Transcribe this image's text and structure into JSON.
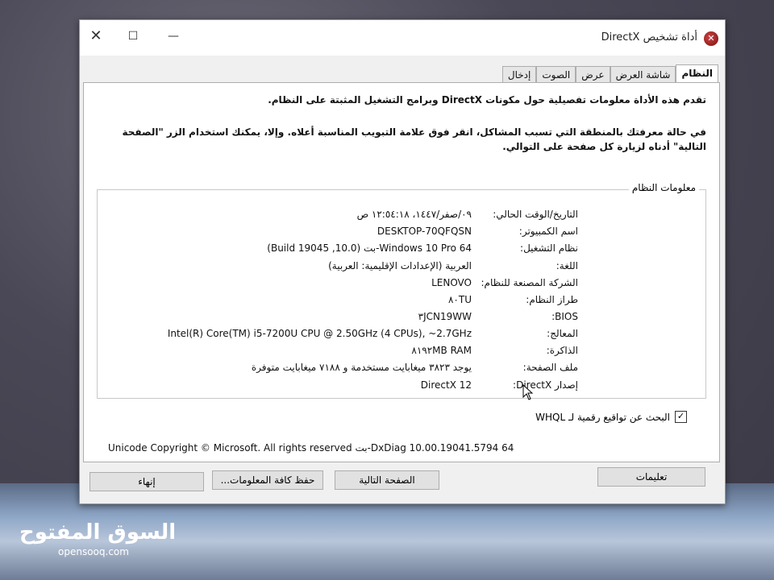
{
  "window": {
    "title": "أداة تشخيص DirectX",
    "close_glyph": "✕",
    "maximize_glyph": "☐",
    "minimize_glyph": "—"
  },
  "tabs": [
    "النظام",
    "شاشة العرض",
    "عرض",
    "الصوت",
    "إدخال"
  ],
  "intro": {
    "line1": "تقدم هذه الأداة معلومات تفصيلية حول مكونات DirectX وبرامج التشغيل المثبتة على النظام.",
    "line2": "في حالة معرفتك بالمنطقة التي تسبب المشاكل، انقر فوق علامة التبويب المناسبة أعلاه. وإلا، يمكنك استخدام الزر \"الصفحة التالية\" أدناه لزيارة كل صفحة على التوالي."
  },
  "system_info": {
    "title": "معلومات النظام",
    "rows": [
      {
        "label": "التاريخ/الوقت الحالي:",
        "value": "٠٩/صفر/١٤٤٧، ١٢:٥٤:١٨ ص"
      },
      {
        "label": "اسم الكمبيوتر:",
        "value": "DESKTOP-70QFQSN"
      },
      {
        "label": "نظام التشغيل:",
        "value": "Windows 10 Pro 64-بت (10.0, Build 19045)"
      },
      {
        "label": "اللغة:",
        "value": "العربية (الإعدادات الإقليمية: العربية)"
      },
      {
        "label": "الشركة المصنعة للنظام:",
        "value": "LENOVO"
      },
      {
        "label": "طراز النظام:",
        "value": "٨٠TU"
      },
      {
        "label": "BIOS:",
        "value": "٣JCN19WW"
      },
      {
        "label": "المعالج:",
        "value": "Intel(R) Core(TM) i5-7200U CPU @ 2.50GHz (4 CPUs), ~2.7GHz"
      },
      {
        "label": "الذاكرة:",
        "value": "٨١٩٢MB RAM"
      },
      {
        "label": "ملف الصفحة:",
        "value": "يوجد ٣٨٢٣ ميغابايت مستخدمة و ٧١٨٨ ميغابايت متوفرة"
      },
      {
        "label": "إصدار DirectX:",
        "value": "DirectX 12"
      }
    ]
  },
  "whql_checkbox": {
    "label": "البحث عن تواقيع رقمية لـ WHQL",
    "checked_glyph": "✓"
  },
  "copyright": "Unicode  Copyright © Microsoft. All rights reserved بت-DxDiag 10.00.19041.5794 64",
  "buttons": {
    "help": "تعليمات",
    "next_page": "الصفحة التالية",
    "save_all": "حفظ كافة المعلومات...",
    "exit": "إنهاء"
  },
  "watermark": {
    "arabic": "السوق المفتوح",
    "latin": "opensooq.com"
  }
}
